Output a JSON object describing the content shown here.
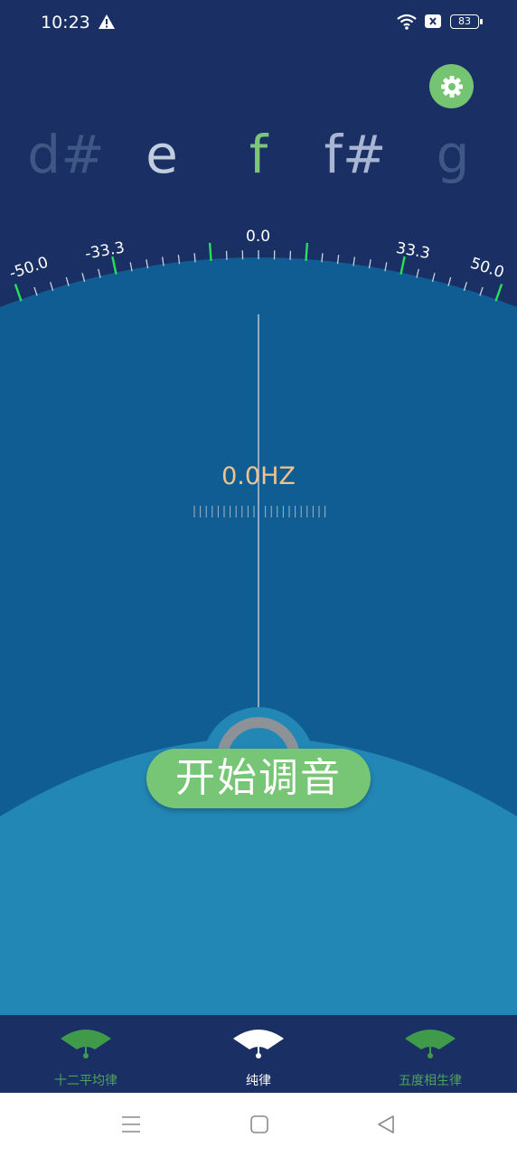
{
  "status_bar": {
    "time": "10:23",
    "battery": "83",
    "icons": [
      "warning-icon",
      "wifi-icon",
      "sim-off-icon",
      "battery-icon"
    ]
  },
  "settings": {
    "icon": "gear-icon",
    "color": "#74c472"
  },
  "notes": [
    "d#",
    "e",
    "f",
    "f#",
    "g"
  ],
  "selected_note": "f",
  "scale": {
    "labels": [
      "-50.0",
      "-33.3",
      "0.0",
      "33.3",
      "50.0"
    ],
    "tick_color_major": "#27e05a"
  },
  "frequency": "0.0HZ",
  "start_button": {
    "label": "开始调音",
    "color": "#77c675"
  },
  "tabs": [
    {
      "label": "十二平均律",
      "active": false
    },
    {
      "label": "纯律",
      "active": true
    },
    {
      "label": "五度相生律",
      "active": false
    }
  ],
  "colors": {
    "background": "#1a2f63",
    "meter_mid": "#0f5d93",
    "meter_front": "#2387b5",
    "accent": "#77c675",
    "frequency_text": "#f2c38c"
  }
}
